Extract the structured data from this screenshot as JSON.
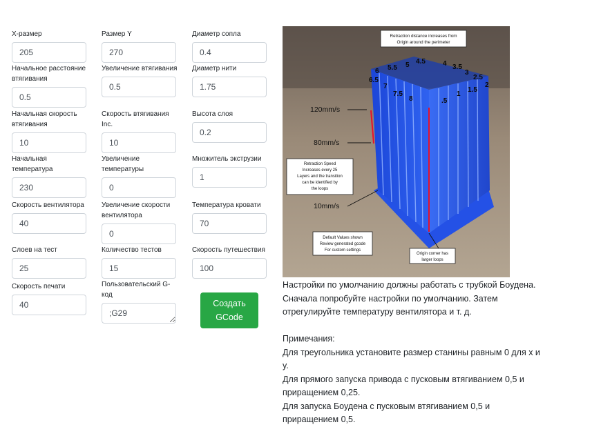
{
  "form": {
    "x_size": {
      "label": "X-размер",
      "value": "205"
    },
    "y_size": {
      "label": "Размер Y",
      "value": "270"
    },
    "nozzle": {
      "label": "Диаметр сопла",
      "value": "0.4"
    },
    "retract_start": {
      "label": "Начальное расстояние втягивания",
      "value": "0.5"
    },
    "retract_inc": {
      "label": "Увеличение втягивания",
      "value": "0.5"
    },
    "filament": {
      "label": "Диаметр нити",
      "value": "1.75"
    },
    "retract_speed": {
      "label": "Начальная скорость втягивания",
      "value": "10"
    },
    "retract_speed_inc": {
      "label": "Скорость втягивания Inc.",
      "value": "10"
    },
    "layer_height": {
      "label": "Высота слоя",
      "value": "0.2"
    },
    "temp_start": {
      "label": "Начальная температура",
      "value": "230"
    },
    "temp_inc": {
      "label": "Увеличение температуры",
      "value": "0"
    },
    "extrusion_mult": {
      "label": "Множитель экструзии",
      "value": "1"
    },
    "fan_speed": {
      "label": "Скорость вентилятора",
      "value": "40"
    },
    "fan_inc": {
      "label": "Увеличение скорости вентилятора",
      "value": "0"
    },
    "bed_temp": {
      "label": "Температура кровати",
      "value": "70"
    },
    "layers_per_test": {
      "label": "Слоев на тест",
      "value": "25"
    },
    "num_tests": {
      "label": "Количество тестов",
      "value": "15"
    },
    "travel_speed": {
      "label": "Скорость путешествия",
      "value": "100"
    },
    "print_speed": {
      "label": "Скорость печати",
      "value": "40"
    },
    "custom_gcode": {
      "label": "Пользовательский G-код",
      "value": ";G29"
    }
  },
  "generate_button": "Создать\nGCode",
  "photo": {
    "top_note": [
      "Retraction distance increases from",
      "Origin around the perimeter"
    ],
    "speed_labels": [
      "120mm/s",
      "80mm/s",
      "10mm/s"
    ],
    "speed_note": [
      "Retraction Speed",
      "Increases every 25",
      "Layers and the transition",
      "can be identified by",
      "the loops"
    ],
    "default_note": [
      "Default Values shown",
      "Review generated gcode",
      "For custom settings"
    ],
    "origin_note": [
      "Origin corner has",
      "larger loops"
    ],
    "distance_numbers": [
      "6",
      "5.5",
      "5",
      "4.5",
      "4",
      "3.5",
      "3",
      "2.5",
      "6.5",
      "7",
      "7.5",
      "8",
      ".5",
      "1",
      "1.5",
      "2"
    ]
  },
  "description": {
    "line1": "Настройки по умолчанию должны работать с трубкой Боудена. Сначала попробуйте настройки по умолчанию. Затем отрегулируйте температуру вентилятора и т. д.",
    "notes_title": "Примечания:",
    "note1": "Для треугольника установите размер станины равным 0 для x и y.",
    "note2": "Для прямого запуска привода с пусковым втягиванием 0,5 и приращением 0,25.",
    "note3": "Для запуска Боудена с пусковым втягиванием 0,5 и приращением 0,5."
  },
  "colors": {
    "button": "#28a745",
    "print": "#1f4fe8",
    "background_table": "#9a8a78"
  }
}
